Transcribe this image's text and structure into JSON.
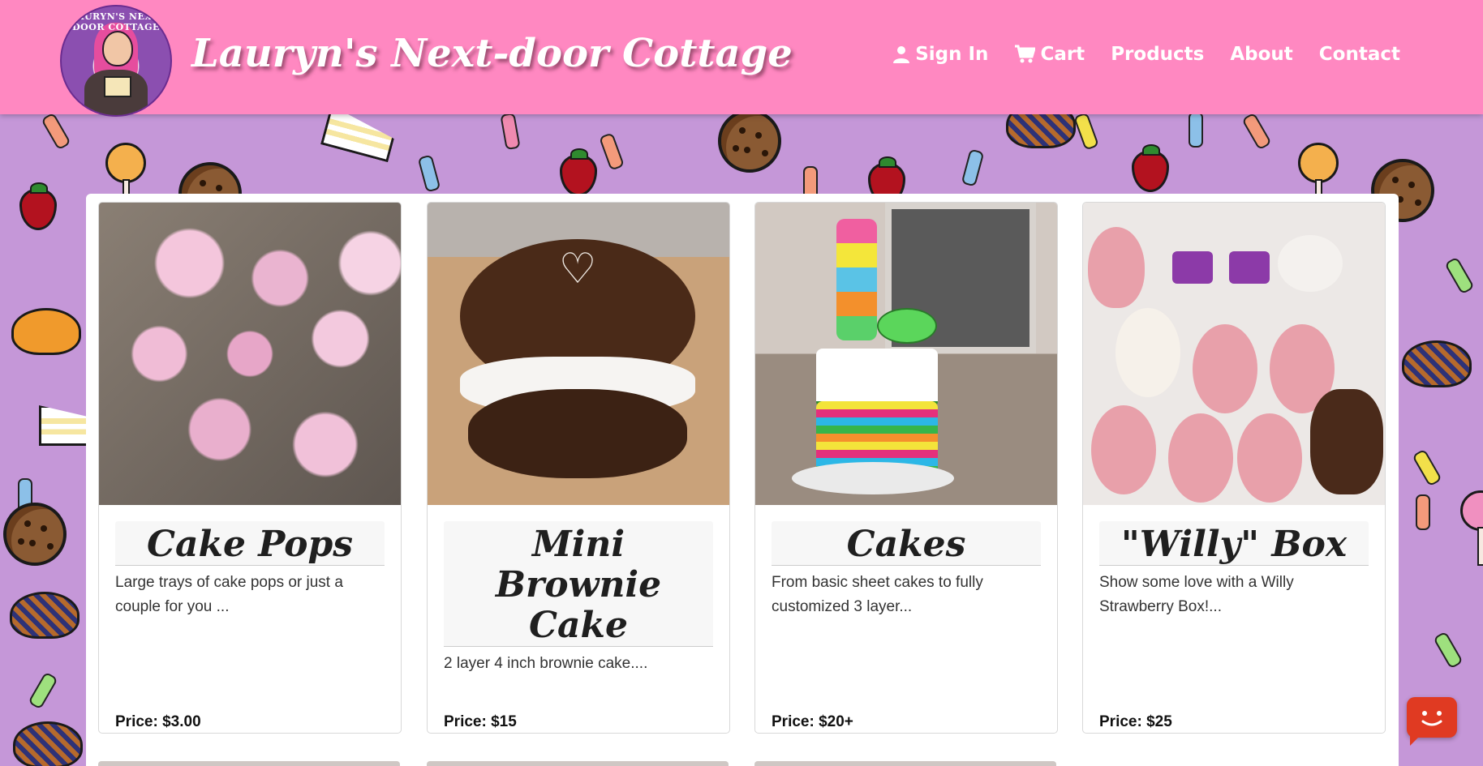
{
  "header": {
    "logo_text": "LAURYN'S NEXT-DOOR COTTAGE",
    "site_title": "Lauryn's Next-door Cottage",
    "nav": [
      {
        "label": "Sign In",
        "icon": "user-icon"
      },
      {
        "label": "Cart",
        "icon": "cart-icon"
      },
      {
        "label": "Products",
        "icon": ""
      },
      {
        "label": "About",
        "icon": ""
      },
      {
        "label": "Contact",
        "icon": ""
      }
    ]
  },
  "products": [
    {
      "title": "Cake Pops",
      "description": "Large trays of cake pops or just a couple for you ...",
      "price": "Price: $3.00"
    },
    {
      "title": "Mini Brownie Cake",
      "description": "2 layer 4 inch brownie cake....",
      "price": "Price: $15"
    },
    {
      "title": "Cakes",
      "description": "From basic sheet cakes to fully customized 3 layer...",
      "price": "Price: $20+"
    },
    {
      "title": "\"Willy\" Box",
      "description": "Show some love with a Willy Strawberry Box!...",
      "price": "Price: $25"
    }
  ],
  "colors": {
    "header_bg": "#ff88c1",
    "page_bg": "#c597d8",
    "chat_widget": "#e03a22"
  }
}
